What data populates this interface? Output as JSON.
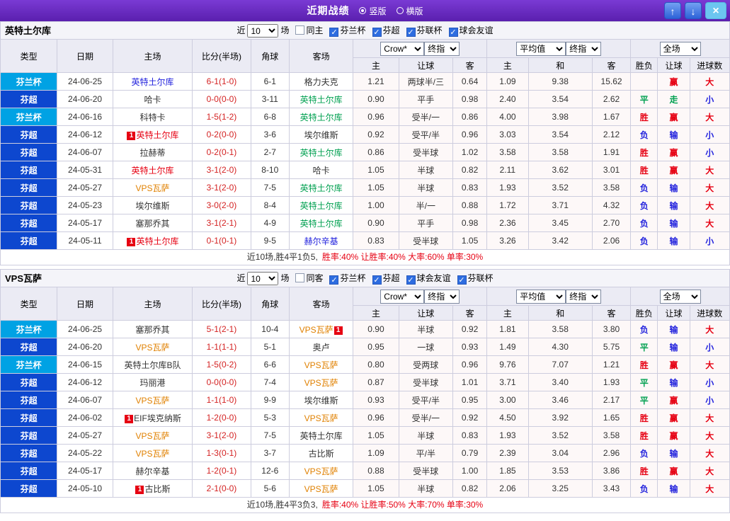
{
  "titlebar": {
    "title": "近期战绩",
    "radios": [
      {
        "label": "竖版",
        "selected": true
      },
      {
        "label": "横版",
        "selected": false
      }
    ],
    "up": "↑",
    "down": "↓",
    "close": "×"
  },
  "icons": {
    "check": "✓"
  },
  "colors": {
    "red": "#e60012",
    "green": "#00a050",
    "blue": "#2222dd",
    "orange": "#e08000",
    "black": "#333333",
    "score": "#d42222",
    "cup_bg": "#00a2e4",
    "league_bg": "#0d47cf",
    "titlebar_bg": "#6a2fc4",
    "header_bg": "#ebebf4"
  },
  "columns": {
    "type": "类型",
    "date": "日期",
    "home": "主场",
    "score": "比分(半场)",
    "corners": "角球",
    "away": "客场",
    "crown_select": "Crow*",
    "crown_final_select": "终指",
    "avg_select": "平均值",
    "avg_final_select": "终指",
    "full_select": "全场",
    "sub": [
      "主",
      "让球",
      "客",
      "主",
      "和",
      "客",
      "胜负",
      "让球",
      "进球数"
    ]
  },
  "tables": [
    {
      "team": "英特土尔库",
      "filter": {
        "near": "近",
        "count": "10",
        "unit": "场",
        "checkboxes": [
          {
            "label": "同主",
            "checked": false
          },
          {
            "label": "芬兰杯",
            "checked": true
          },
          {
            "label": "芬超",
            "checked": true
          },
          {
            "label": "芬联杯",
            "checked": true
          },
          {
            "label": "球会友谊",
            "checked": true
          }
        ]
      },
      "rows": [
        {
          "lg": "芬兰杯",
          "lgc": "cup",
          "d": "24-06-25",
          "h": "英特土尔库",
          "hc": "blue",
          "hb": "",
          "hbp": "",
          "s": "6-1(1-0)",
          "cn": "6-1",
          "a": "格力夫克",
          "ac": "black",
          "ab": "",
          "abp": "",
          "o1": "1.21",
          "hd": "两球半/三",
          "o2": "0.64",
          "e1": "1.09",
          "e2": "9.38",
          "e3": "15.62",
          "r1": "",
          "c1": "",
          "r2": "赢",
          "c2": "red",
          "r3": "大",
          "c3": "red"
        },
        {
          "lg": "芬超",
          "lgc": "league",
          "d": "24-06-20",
          "h": "哈卡",
          "hc": "black",
          "hb": "",
          "hbp": "",
          "s": "0-0(0-0)",
          "cn": "3-11",
          "a": "英特土尔库",
          "ac": "green",
          "ab": "",
          "abp": "",
          "o1": "0.90",
          "hd": "平手",
          "o2": "0.98",
          "e1": "2.40",
          "e2": "3.54",
          "e3": "2.62",
          "r1": "平",
          "c1": "green",
          "r2": "走",
          "c2": "green",
          "r3": "小",
          "c3": "blue"
        },
        {
          "lg": "芬兰杯",
          "lgc": "cup",
          "d": "24-06-16",
          "h": "科特卡",
          "hc": "black",
          "hb": "",
          "hbp": "",
          "s": "1-5(1-2)",
          "cn": "6-8",
          "a": "英特土尔库",
          "ac": "green",
          "ab": "",
          "abp": "",
          "o1": "0.96",
          "hd": "受半/一",
          "o2": "0.86",
          "e1": "4.00",
          "e2": "3.98",
          "e3": "1.67",
          "r1": "胜",
          "c1": "red",
          "r2": "赢",
          "c2": "red",
          "r3": "大",
          "c3": "red"
        },
        {
          "lg": "芬超",
          "lgc": "league",
          "d": "24-06-12",
          "h": "英特土尔库",
          "hc": "red",
          "hb": "1",
          "hbp": "before",
          "s": "0-2(0-0)",
          "cn": "3-6",
          "a": "埃尔维斯",
          "ac": "black",
          "ab": "",
          "abp": "",
          "o1": "0.92",
          "hd": "受平/半",
          "o2": "0.96",
          "e1": "3.03",
          "e2": "3.54",
          "e3": "2.12",
          "r1": "负",
          "c1": "blue",
          "r2": "输",
          "c2": "blue",
          "r3": "小",
          "c3": "blue"
        },
        {
          "lg": "芬超",
          "lgc": "league",
          "d": "24-06-07",
          "h": "拉赫蒂",
          "hc": "black",
          "hb": "",
          "hbp": "",
          "s": "0-2(0-1)",
          "cn": "2-7",
          "a": "英特土尔库",
          "ac": "green",
          "ab": "",
          "abp": "",
          "o1": "0.86",
          "hd": "受半球",
          "o2": "1.02",
          "e1": "3.58",
          "e2": "3.58",
          "e3": "1.91",
          "r1": "胜",
          "c1": "red",
          "r2": "赢",
          "c2": "red",
          "r3": "小",
          "c3": "blue"
        },
        {
          "lg": "芬超",
          "lgc": "league",
          "d": "24-05-31",
          "h": "英特土尔库",
          "hc": "red",
          "hb": "",
          "hbp": "",
          "s": "3-1(2-0)",
          "cn": "8-10",
          "a": "哈卡",
          "ac": "black",
          "ab": "",
          "abp": "",
          "o1": "1.05",
          "hd": "半球",
          "o2": "0.82",
          "e1": "2.11",
          "e2": "3.62",
          "e3": "3.01",
          "r1": "胜",
          "c1": "red",
          "r2": "赢",
          "c2": "red",
          "r3": "大",
          "c3": "red"
        },
        {
          "lg": "芬超",
          "lgc": "league",
          "d": "24-05-27",
          "h": "VPS瓦萨",
          "hc": "orange",
          "hb": "",
          "hbp": "",
          "s": "3-1(2-0)",
          "cn": "7-5",
          "a": "英特土尔库",
          "ac": "green",
          "ab": "",
          "abp": "",
          "o1": "1.05",
          "hd": "半球",
          "o2": "0.83",
          "e1": "1.93",
          "e2": "3.52",
          "e3": "3.58",
          "r1": "负",
          "c1": "blue",
          "r2": "输",
          "c2": "blue",
          "r3": "大",
          "c3": "red"
        },
        {
          "lg": "芬超",
          "lgc": "league",
          "d": "24-05-23",
          "h": "埃尔维斯",
          "hc": "black",
          "hb": "",
          "hbp": "",
          "s": "3-0(2-0)",
          "cn": "8-4",
          "a": "英特土尔库",
          "ac": "green",
          "ab": "",
          "abp": "",
          "o1": "1.00",
          "hd": "半/一",
          "o2": "0.88",
          "e1": "1.72",
          "e2": "3.71",
          "e3": "4.32",
          "r1": "负",
          "c1": "blue",
          "r2": "输",
          "c2": "blue",
          "r3": "大",
          "c3": "red"
        },
        {
          "lg": "芬超",
          "lgc": "league",
          "d": "24-05-17",
          "h": "塞那乔其",
          "hc": "black",
          "hb": "",
          "hbp": "",
          "s": "3-1(2-1)",
          "cn": "4-9",
          "a": "英特土尔库",
          "ac": "green",
          "ab": "",
          "abp": "",
          "o1": "0.90",
          "hd": "平手",
          "o2": "0.98",
          "e1": "2.36",
          "e2": "3.45",
          "e3": "2.70",
          "r1": "负",
          "c1": "blue",
          "r2": "输",
          "c2": "blue",
          "r3": "大",
          "c3": "red"
        },
        {
          "lg": "芬超",
          "lgc": "league",
          "d": "24-05-11",
          "h": "英特土尔库",
          "hc": "red",
          "hb": "1",
          "hbp": "before",
          "s": "0-1(0-1)",
          "cn": "9-5",
          "a": "赫尔辛基",
          "ac": "blue",
          "ab": "",
          "abp": "",
          "o1": "0.83",
          "hd": "受半球",
          "o2": "1.05",
          "e1": "3.26",
          "e2": "3.42",
          "e3": "2.06",
          "r1": "负",
          "c1": "blue",
          "r2": "输",
          "c2": "blue",
          "r3": "小",
          "c3": "blue"
        }
      ],
      "summary_lead": "近10场,胜4平1负5,",
      "summary_stats": "胜率:40%  让胜率:40%  大率:60%  单率:30%"
    },
    {
      "team": "VPS瓦萨",
      "filter": {
        "near": "近",
        "count": "10",
        "unit": "场",
        "checkboxes": [
          {
            "label": "同客",
            "checked": false
          },
          {
            "label": "芬兰杯",
            "checked": true
          },
          {
            "label": "芬超",
            "checked": true
          },
          {
            "label": "球会友谊",
            "checked": true
          },
          {
            "label": "芬联杯",
            "checked": true
          }
        ]
      },
      "rows": [
        {
          "lg": "芬兰杯",
          "lgc": "cup",
          "d": "24-06-25",
          "h": "塞那乔其",
          "hc": "black",
          "hb": "",
          "hbp": "",
          "s": "5-1(2-1)",
          "cn": "10-4",
          "a": "VPS瓦萨",
          "ac": "orange",
          "ab": "1",
          "abp": "after",
          "o1": "0.90",
          "hd": "半球",
          "o2": "0.92",
          "e1": "1.81",
          "e2": "3.58",
          "e3": "3.80",
          "r1": "负",
          "c1": "blue",
          "r2": "输",
          "c2": "blue",
          "r3": "大",
          "c3": "red"
        },
        {
          "lg": "芬超",
          "lgc": "league",
          "d": "24-06-20",
          "h": "VPS瓦萨",
          "hc": "orange",
          "hb": "",
          "hbp": "",
          "s": "1-1(1-1)",
          "cn": "5-1",
          "a": "奥卢",
          "ac": "black",
          "ab": "",
          "abp": "",
          "o1": "0.95",
          "hd": "一球",
          "o2": "0.93",
          "e1": "1.49",
          "e2": "4.30",
          "e3": "5.75",
          "r1": "平",
          "c1": "green",
          "r2": "输",
          "c2": "blue",
          "r3": "小",
          "c3": "blue"
        },
        {
          "lg": "芬兰杯",
          "lgc": "cup",
          "d": "24-06-15",
          "h": "英特土尔库B队",
          "hc": "black",
          "hb": "",
          "hbp": "",
          "s": "1-5(0-2)",
          "cn": "6-6",
          "a": "VPS瓦萨",
          "ac": "orange",
          "ab": "",
          "abp": "",
          "o1": "0.80",
          "hd": "受两球",
          "o2": "0.96",
          "e1": "9.76",
          "e2": "7.07",
          "e3": "1.21",
          "r1": "胜",
          "c1": "red",
          "r2": "赢",
          "c2": "red",
          "r3": "大",
          "c3": "red"
        },
        {
          "lg": "芬超",
          "lgc": "league",
          "d": "24-06-12",
          "h": "玛丽港",
          "hc": "black",
          "hb": "",
          "hbp": "",
          "s": "0-0(0-0)",
          "cn": "7-4",
          "a": "VPS瓦萨",
          "ac": "orange",
          "ab": "",
          "abp": "",
          "o1": "0.87",
          "hd": "受半球",
          "o2": "1.01",
          "e1": "3.71",
          "e2": "3.40",
          "e3": "1.93",
          "r1": "平",
          "c1": "green",
          "r2": "输",
          "c2": "blue",
          "r3": "小",
          "c3": "blue"
        },
        {
          "lg": "芬超",
          "lgc": "league",
          "d": "24-06-07",
          "h": "VPS瓦萨",
          "hc": "orange",
          "hb": "",
          "hbp": "",
          "s": "1-1(1-0)",
          "cn": "9-9",
          "a": "埃尔维斯",
          "ac": "black",
          "ab": "",
          "abp": "",
          "o1": "0.93",
          "hd": "受平/半",
          "o2": "0.95",
          "e1": "3.00",
          "e2": "3.46",
          "e3": "2.17",
          "r1": "平",
          "c1": "green",
          "r2": "赢",
          "c2": "red",
          "r3": "小",
          "c3": "blue"
        },
        {
          "lg": "芬超",
          "lgc": "league",
          "d": "24-06-02",
          "h": "EIF埃克纳斯",
          "hc": "black",
          "hb": "1",
          "hbp": "before",
          "s": "1-2(0-0)",
          "cn": "5-3",
          "a": "VPS瓦萨",
          "ac": "orange",
          "ab": "",
          "abp": "",
          "o1": "0.96",
          "hd": "受半/一",
          "o2": "0.92",
          "e1": "4.50",
          "e2": "3.92",
          "e3": "1.65",
          "r1": "胜",
          "c1": "red",
          "r2": "赢",
          "c2": "red",
          "r3": "大",
          "c3": "red"
        },
        {
          "lg": "芬超",
          "lgc": "league",
          "d": "24-05-27",
          "h": "VPS瓦萨",
          "hc": "orange",
          "hb": "",
          "hbp": "",
          "s": "3-1(2-0)",
          "cn": "7-5",
          "a": "英特土尔库",
          "ac": "black",
          "ab": "",
          "abp": "",
          "o1": "1.05",
          "hd": "半球",
          "o2": "0.83",
          "e1": "1.93",
          "e2": "3.52",
          "e3": "3.58",
          "r1": "胜",
          "c1": "red",
          "r2": "赢",
          "c2": "red",
          "r3": "大",
          "c3": "red"
        },
        {
          "lg": "芬超",
          "lgc": "league",
          "d": "24-05-22",
          "h": "VPS瓦萨",
          "hc": "orange",
          "hb": "",
          "hbp": "",
          "s": "1-3(0-1)",
          "cn": "3-7",
          "a": "古比斯",
          "ac": "black",
          "ab": "",
          "abp": "",
          "o1": "1.09",
          "hd": "平/半",
          "o2": "0.79",
          "e1": "2.39",
          "e2": "3.04",
          "e3": "2.96",
          "r1": "负",
          "c1": "blue",
          "r2": "输",
          "c2": "blue",
          "r3": "大",
          "c3": "red"
        },
        {
          "lg": "芬超",
          "lgc": "league",
          "d": "24-05-17",
          "h": "赫尔辛基",
          "hc": "black",
          "hb": "",
          "hbp": "",
          "s": "1-2(0-1)",
          "cn": "12-6",
          "a": "VPS瓦萨",
          "ac": "orange",
          "ab": "",
          "abp": "",
          "o1": "0.88",
          "hd": "受半球",
          "o2": "1.00",
          "e1": "1.85",
          "e2": "3.53",
          "e3": "3.86",
          "r1": "胜",
          "c1": "red",
          "r2": "赢",
          "c2": "red",
          "r3": "大",
          "c3": "red"
        },
        {
          "lg": "芬超",
          "lgc": "league",
          "d": "24-05-10",
          "h": "古比斯",
          "hc": "black",
          "hb": "1",
          "hbp": "before",
          "s": "2-1(0-0)",
          "cn": "5-6",
          "a": "VPS瓦萨",
          "ac": "orange",
          "ab": "",
          "abp": "",
          "o1": "1.05",
          "hd": "半球",
          "o2": "0.82",
          "e1": "2.06",
          "e2": "3.25",
          "e3": "3.43",
          "r1": "负",
          "c1": "blue",
          "r2": "输",
          "c2": "blue",
          "r3": "大",
          "c3": "red"
        }
      ],
      "summary_lead": "近10场,胜4平3负3,",
      "summary_stats": "胜率:40%  让胜率:50%  大率:70%  单率:30%"
    }
  ]
}
